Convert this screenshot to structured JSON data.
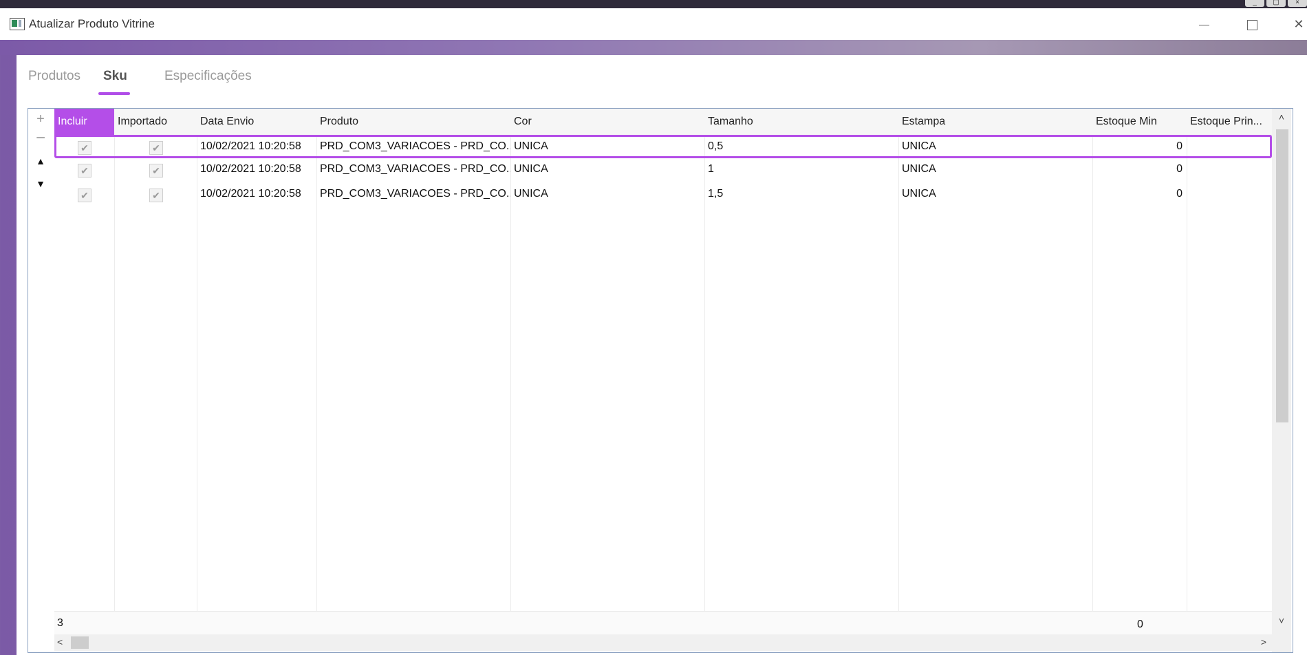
{
  "window": {
    "title": "Atualizar Produto Vitrine"
  },
  "tabs": [
    {
      "label": "Produtos"
    },
    {
      "label": "Sku"
    },
    {
      "label": "Especificações"
    }
  ],
  "grid": {
    "columns": [
      "Incluir",
      "Importado",
      "Data Envio",
      "Produto",
      "Cor",
      "Tamanho",
      "Estampa",
      "Estoque Min",
      "Estoque Prin..."
    ],
    "rows": [
      {
        "data_envio": "10/02/2021 10:20:58",
        "produto": "PRD_COM3_VARIACOES - PRD_CO...",
        "cor": "UNICA",
        "tamanho": "0,5",
        "estampa": "UNICA",
        "estoque_min": "0"
      },
      {
        "data_envio": "10/02/2021 10:20:58",
        "produto": "PRD_COM3_VARIACOES - PRD_CO...",
        "cor": "UNICA",
        "tamanho": "1",
        "estampa": "UNICA",
        "estoque_min": "0"
      },
      {
        "data_envio": "10/02/2021 10:20:58",
        "produto": "PRD_COM3_VARIACOES - PRD_CO...",
        "cor": "UNICA",
        "tamanho": "1,5",
        "estampa": "UNICA",
        "estoque_min": "0"
      }
    ],
    "summary": {
      "count": "3",
      "estoque_min_total": "0"
    },
    "row_controls": {
      "add": "+",
      "remove": "−",
      "up": "▲",
      "down": "▼"
    }
  },
  "colors": {
    "accent": "#b44ee8"
  },
  "icons": {
    "check": "✔",
    "scroll_left": "<",
    "scroll_right": ">",
    "scroll_up": "˄",
    "scroll_down": "˅"
  }
}
